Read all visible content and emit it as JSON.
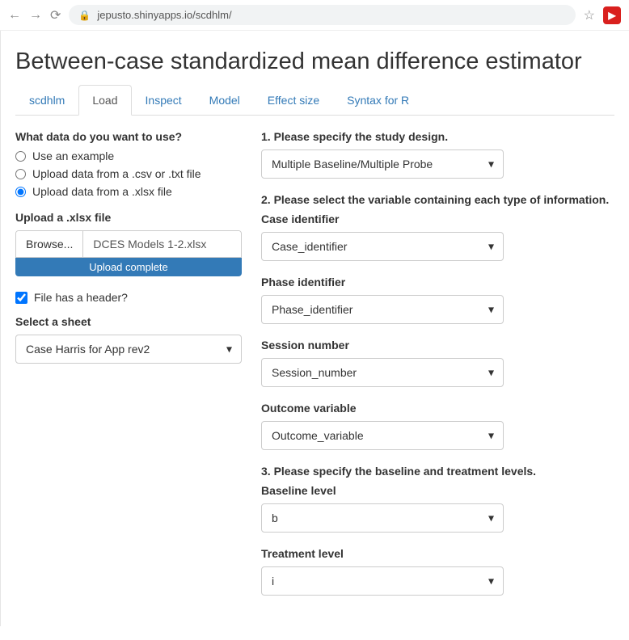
{
  "browser": {
    "url": "jepusto.shinyapps.io/scdhlm/"
  },
  "page_title": "Between-case standardized mean difference estimator",
  "tabs": [
    "scdhlm",
    "Load",
    "Inspect",
    "Model",
    "Effect size",
    "Syntax for R"
  ],
  "active_tab": "Load",
  "left": {
    "q_what_data": "What data do you want to use?",
    "radio_example": "Use an example",
    "radio_csv": "Upload data from a .csv or .txt file",
    "radio_xlsx": "Upload data from a .xlsx file",
    "upload_label": "Upload a .xlsx file",
    "browse_label": "Browse...",
    "file_name": "DCES Models 1-2.xlsx",
    "upload_status": "Upload complete",
    "header_checkbox_label": "File has a header?",
    "select_sheet_label": "Select a sheet",
    "selected_sheet": "Case Harris for App rev2"
  },
  "right": {
    "q1": "1. Please specify the study design.",
    "study_design_value": "Multiple Baseline/Multiple Probe",
    "q2": "2. Please select the variable containing each type of information.",
    "case_id_label": "Case identifier",
    "case_id_value": "Case_identifier",
    "phase_id_label": "Phase identifier",
    "phase_id_value": "Phase_identifier",
    "session_label": "Session number",
    "session_value": "Session_number",
    "outcome_label": "Outcome variable",
    "outcome_value": "Outcome_variable",
    "q3": "3. Please specify the baseline and treatment levels.",
    "baseline_label": "Baseline level",
    "baseline_value": "b",
    "treatment_label": "Treatment level",
    "treatment_value": "i"
  }
}
